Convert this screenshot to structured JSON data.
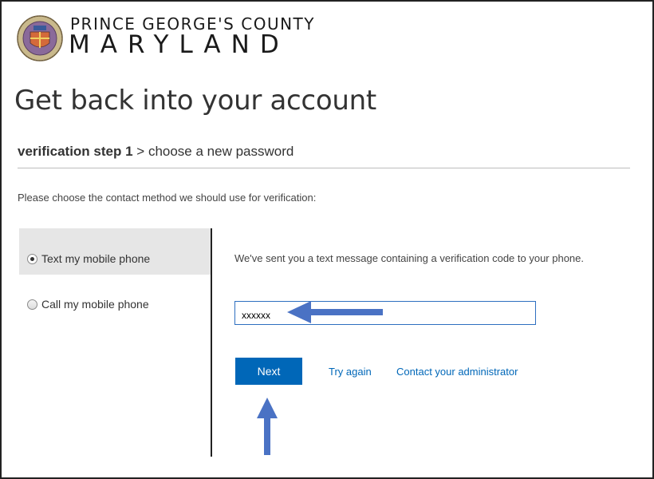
{
  "logo": {
    "line1": "PRINCE GEORGE'S COUNTY",
    "line2": "MARYLAND"
  },
  "page": {
    "title": "Get back into your account"
  },
  "steps": {
    "current": "verification step 1",
    "separator": " > ",
    "next": "choose a new password"
  },
  "instruction": "Please choose the contact method we should use for verification:",
  "methods": [
    {
      "label": "Text my mobile phone",
      "selected": true
    },
    {
      "label": "Call my mobile phone",
      "selected": false
    }
  ],
  "verification": {
    "message": "We've sent you a text message containing a verification code to your phone.",
    "code_value": "xxxxxx"
  },
  "actions": {
    "next_label": "Next",
    "try_again": "Try again",
    "contact_admin": "Contact your administrator"
  },
  "colors": {
    "accent": "#0067b8",
    "annotation_arrow": "#4a72c4",
    "selected_row": "#e6e6e6"
  },
  "icons": {
    "logo": "county-seal-icon",
    "annotation_left": "arrow-left-icon",
    "annotation_up": "arrow-up-icon"
  }
}
